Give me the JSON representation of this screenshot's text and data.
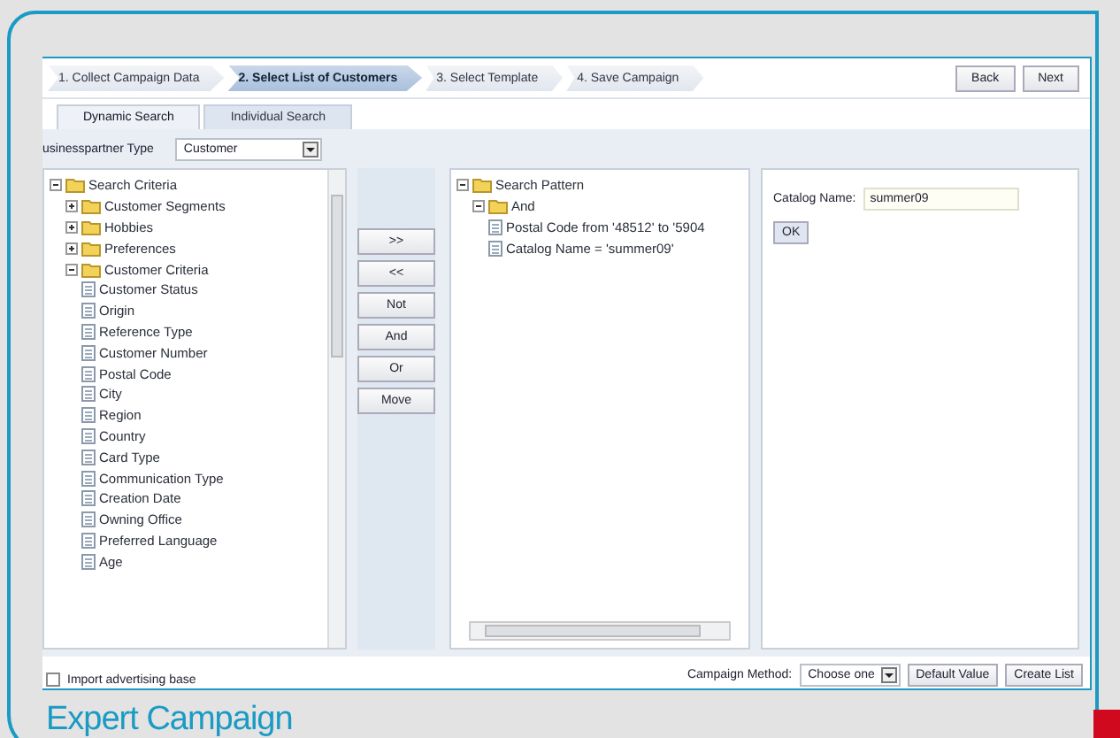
{
  "steps": [
    {
      "label": "1. Collect Campaign Data",
      "selected": false
    },
    {
      "label": "2. Select List of Customers",
      "selected": true
    },
    {
      "label": "3. Select Template",
      "selected": false
    },
    {
      "label": "4. Save Campaign",
      "selected": false
    }
  ],
  "nav_buttons": [
    "Back",
    "Next"
  ],
  "tabs": [
    {
      "label": "Dynamic Search",
      "selected": true
    },
    {
      "label": "Individual Search",
      "selected": false
    }
  ],
  "partner_type": {
    "label": "usinesspartner Type",
    "value": "Customer"
  },
  "criteria_tree": [
    {
      "label": "Search Criteria",
      "kind": "folder",
      "expanded": true,
      "children": [
        {
          "label": "Customer Segments",
          "kind": "folder",
          "expanded": false
        },
        {
          "label": "Hobbies",
          "kind": "folder",
          "expanded": false
        },
        {
          "label": "Preferences",
          "kind": "folder",
          "expanded": false
        },
        {
          "label": "Customer Criteria",
          "kind": "folder",
          "expanded": true,
          "children": [
            {
              "label": "Customer Status",
              "kind": "field"
            },
            {
              "label": "Origin",
              "kind": "field"
            },
            {
              "label": "Reference Type",
              "kind": "field"
            },
            {
              "label": "Customer Number",
              "kind": "field"
            },
            {
              "label": "Postal Code",
              "kind": "field"
            },
            {
              "label": "City",
              "kind": "field"
            },
            {
              "label": "Region",
              "kind": "field"
            },
            {
              "label": "Country",
              "kind": "field"
            },
            {
              "label": "Card Type",
              "kind": "field"
            },
            {
              "label": "Communication Type",
              "kind": "field"
            },
            {
              "label": "Creation Date",
              "kind": "field"
            },
            {
              "label": "Owning Office",
              "kind": "field"
            },
            {
              "label": "Preferred Language",
              "kind": "field"
            },
            {
              "label": "Age",
              "kind": "field"
            }
          ]
        }
      ]
    }
  ],
  "operator_buttons": [
    ">>",
    "<<",
    "Not",
    "And",
    "Or",
    "Move"
  ],
  "pattern_tree": [
    {
      "label": "Search Pattern",
      "kind": "folder",
      "expanded": true,
      "children": [
        {
          "label": "And",
          "kind": "folder",
          "expanded": true,
          "children": [
            {
              "label": "Postal Code from '48512' to '5904",
              "kind": "field"
            },
            {
              "label": "Catalog Name = 'summer09'",
              "kind": "field"
            }
          ]
        }
      ]
    }
  ],
  "detail": {
    "label": "Catalog Name:",
    "value": "summer09",
    "button": "OK"
  },
  "footer": {
    "checkbox_checked": false,
    "checkbox_label": "Import advertising base",
    "method_label": "Campaign Method:",
    "method_value": "Choose one",
    "buttons": [
      "Default Value",
      "Create List"
    ]
  },
  "caption": "Expert Campaign"
}
